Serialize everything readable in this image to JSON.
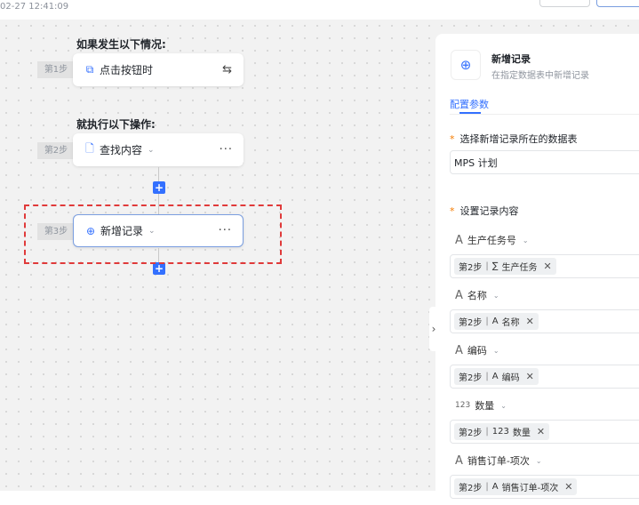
{
  "header": {
    "timestamp": "02-27 12:41:09"
  },
  "flow": {
    "trigger_title": "如果发生以下情况:",
    "action_title": "就执行以下操作:",
    "steps": [
      {
        "step": "第1步",
        "label": "点击按钮时",
        "icon": "cursor-click-icon",
        "action": "swap-icon"
      },
      {
        "step": "第2步",
        "label": "查找内容",
        "icon": "search-doc-icon",
        "action": "more-icon"
      },
      {
        "step": "第3步",
        "label": "新增记录",
        "icon": "plus-circle-icon",
        "action": "more-icon"
      }
    ]
  },
  "panel": {
    "title": "新增记录",
    "subtitle": "在指定数据表中新增记录",
    "tab": "配置参数",
    "table_label": "选择新增记录所在的数据表",
    "table_value": "MPS 计划",
    "content_label": "设置记录内容",
    "fields": [
      {
        "type": "A",
        "name": "生产任务号",
        "tag_step": "第2步",
        "tag_type": "∑",
        "tag_name": "生产任务"
      },
      {
        "type": "A",
        "name": "名称",
        "tag_step": "第2步",
        "tag_type": "A",
        "tag_name": "名称"
      },
      {
        "type": "A",
        "name": "编码",
        "tag_step": "第2步",
        "tag_type": "A",
        "tag_name": "编码"
      },
      {
        "type": "123",
        "name": "数量",
        "tag_step": "第2步",
        "tag_type": "123",
        "tag_name": "数量"
      },
      {
        "type": "A",
        "name": "销售订单-项次",
        "tag_step": "第2步",
        "tag_type": "A",
        "tag_name": "销售订单-项次"
      }
    ]
  },
  "colors": {
    "accent": "#3370ff",
    "highlight": "#e03a3a",
    "required": "#f57c00"
  }
}
